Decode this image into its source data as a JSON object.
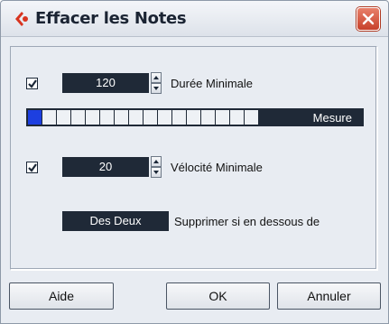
{
  "window": {
    "title": "Effacer les Notes",
    "icon": "cubase-logo-icon",
    "close_icon": "close-icon"
  },
  "duration": {
    "checked": true,
    "value": "120",
    "label": "Durée Minimale"
  },
  "ruler": {
    "segments": 16,
    "active_segments": 1,
    "label": "Mesure",
    "active_color": "#1d3fe0"
  },
  "velocity": {
    "checked": true,
    "value": "20",
    "label": "Vélocité Minimale"
  },
  "mode": {
    "value": "Des Deux",
    "label": "Supprimer si en dessous de"
  },
  "buttons": {
    "help": "Aide",
    "ok": "OK",
    "cancel": "Annuler"
  },
  "colors": {
    "field_bg": "#1f2937",
    "close_red": "#c7402a"
  }
}
